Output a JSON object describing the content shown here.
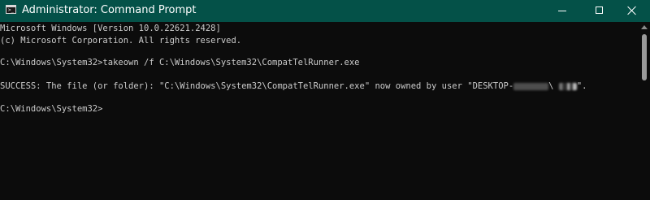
{
  "window": {
    "title": "Administrator: Command Prompt",
    "icon": "cmd-icon",
    "controls": {
      "minimize": "minimize-icon",
      "maximize": "maximize-icon",
      "close": "close-icon"
    },
    "accent_color": "#045148"
  },
  "console": {
    "background": "#0c0c0c",
    "foreground": "#cccccc",
    "lines": {
      "version": "Microsoft Windows [Version 10.0.22621.2428]",
      "copyright": "(c) Microsoft Corporation. All rights reserved.",
      "command": "C:\\Windows\\System32>takeown /f C:\\Windows\\System32\\CompatTelRunner.exe",
      "result_prefix": "SUCCESS: The file (or folder): \"C:\\Windows\\System32\\CompatTelRunner.exe\" now owned by user \"DESKTOP-",
      "result_separator": "\\",
      "result_suffix": "\".",
      "prompt": "C:\\Windows\\System32>"
    }
  }
}
